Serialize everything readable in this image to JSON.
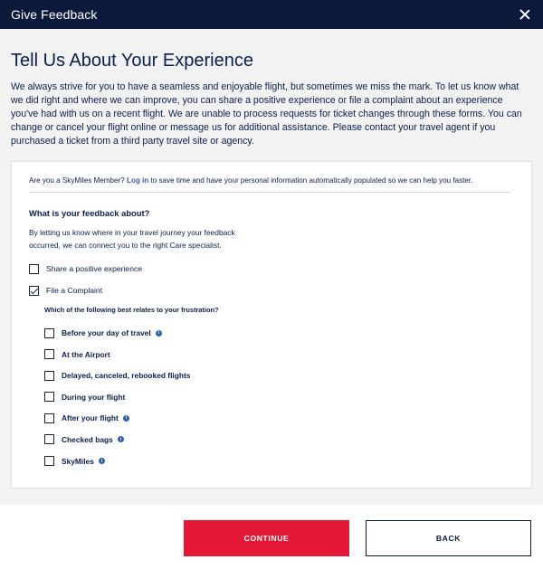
{
  "header": {
    "title": "Give Feedback"
  },
  "main": {
    "heading": "Tell Us About Your Experience",
    "intro": "We always strive for you to have a seamless and enjoyable flight, but sometimes we miss the mark. To let us know what we did right and where we can improve, you can share a positive experience or file a complaint about an experience you've had with us on a recent flight. We are unable to process requests for ticket changes through these forms. You can change or cancel your flight online or message us for additional assistance. Please contact your travel agent if you purchased a ticket from a third party travel site or agency."
  },
  "member": {
    "prefix": "Are you a SkyMiles Member?",
    "link": "Log in",
    "suffix": "to save time and have your personal information automatically populated so we can help you faster."
  },
  "feedback": {
    "question": "What is your feedback about?",
    "description": "By letting us know where in your travel journey your feedback occurred, we can connect you to the right Care specialist.",
    "options": [
      {
        "label": "Share a positive experience",
        "checked": false
      },
      {
        "label": "File a Complaint",
        "checked": true
      }
    ],
    "sub_question": "Which of the following best relates to your frustration?",
    "sub_options": [
      {
        "label": "Before your day of travel",
        "info": true
      },
      {
        "label": "At the Airport",
        "info": false
      },
      {
        "label": "Delayed, canceled, rebooked flights",
        "info": false
      },
      {
        "label": "During your flight",
        "info": false
      },
      {
        "label": "After your flight",
        "info": true
      },
      {
        "label": "Checked bags",
        "info": true
      },
      {
        "label": "SkyMiles",
        "info": true
      }
    ]
  },
  "footer": {
    "continue_label": "CONTINUE",
    "back_label": "BACK"
  },
  "icons": {
    "close": "close-icon",
    "info": "info-icon",
    "checkbox": "checkbox-icon"
  },
  "colors": {
    "header_bg": "#0b1a3a",
    "accent_red": "#e31837",
    "link_blue": "#2f5fa8",
    "text_navy": "#0b1f4d"
  }
}
